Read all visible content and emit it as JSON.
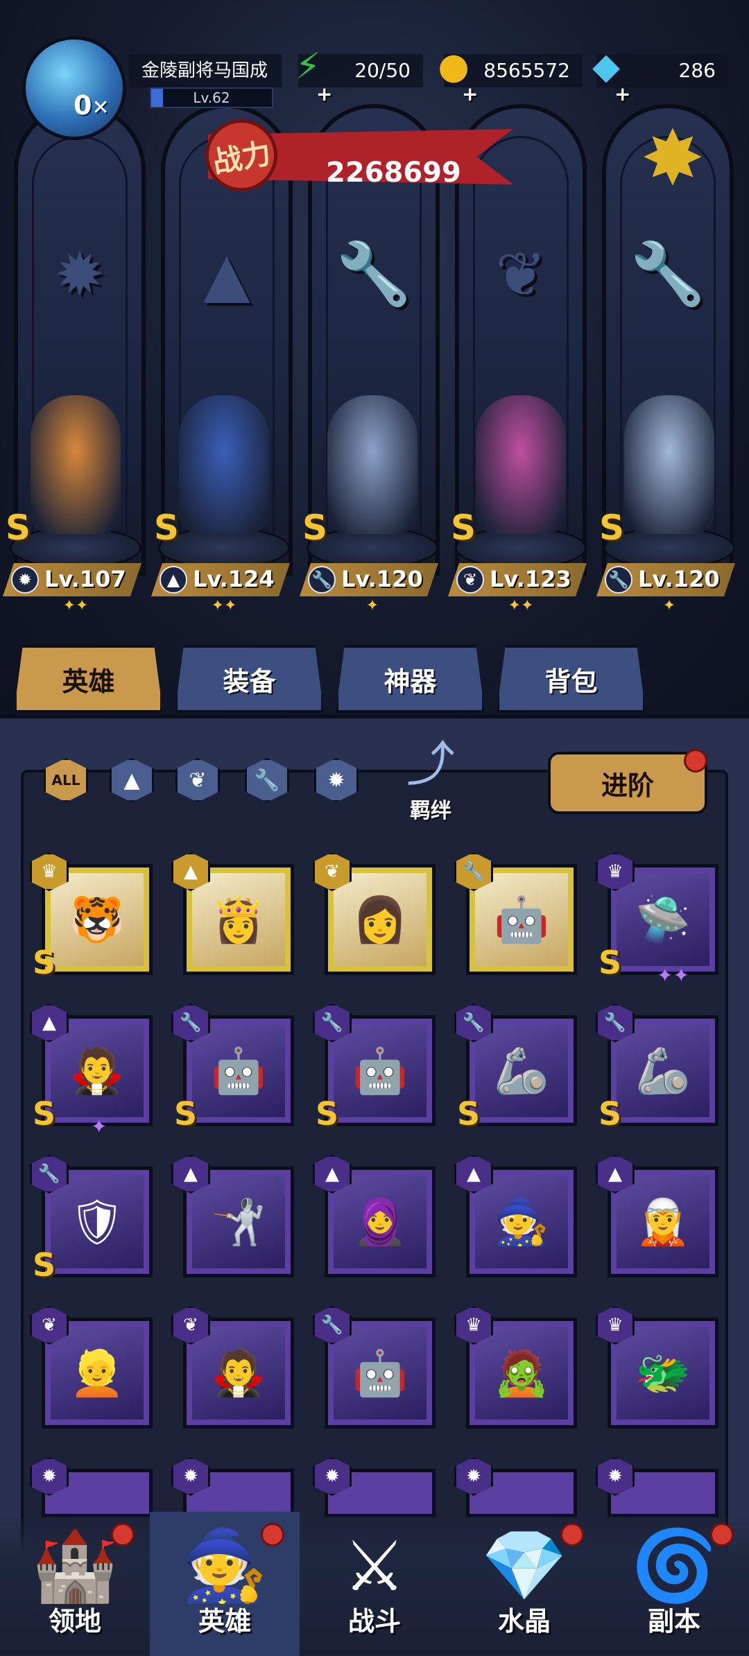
{
  "header": {
    "avatar_vip": "0",
    "avatar_close": "✕",
    "player_name": "金陵副将马国成",
    "player_level": "Lv.62",
    "stamina": "20/50",
    "gold": "8565572",
    "diamonds": "286",
    "power_badge": "战力",
    "power_value": "2268699"
  },
  "heroes_lineup": [
    {
      "level": "Lv.107",
      "rank": "S",
      "stars": "✦✦",
      "class_icon": "beast-claw-icon",
      "color": "#d8883a"
    },
    {
      "level": "Lv.124",
      "rank": "S",
      "stars": "✦✦",
      "class_icon": "mage-hat-icon",
      "color": "#3a5fb8"
    },
    {
      "level": "Lv.120",
      "rank": "S",
      "stars": "✦",
      "class_icon": "wrench-icon",
      "color": "#8ba2c8"
    },
    {
      "level": "Lv.123",
      "rank": "S",
      "stars": "✦✦",
      "class_icon": "wing-icon",
      "color": "#c04fa0"
    },
    {
      "level": "Lv.120",
      "rank": "S",
      "stars": "✦",
      "class_icon": "wrench-icon",
      "color": "#a0b8d8"
    }
  ],
  "tabs": [
    "英雄",
    "装备",
    "神器",
    "背包"
  ],
  "filters": {
    "all": "ALL",
    "bond_label": "羁绊",
    "advance_label": "进阶"
  },
  "grid": [
    {
      "frame": "gold",
      "class": "♛",
      "rank": "S",
      "star": "",
      "portrait": "🐯"
    },
    {
      "frame": "gold",
      "class": "▲",
      "rank": "",
      "star": "",
      "portrait": "👸"
    },
    {
      "frame": "gold",
      "class": "❦",
      "rank": "",
      "star": "",
      "portrait": "👩"
    },
    {
      "frame": "gold",
      "class": "🔧",
      "rank": "",
      "star": "",
      "portrait": "🤖"
    },
    {
      "frame": "purple",
      "class": "♛",
      "rank": "S",
      "star": "✦✦",
      "portrait": "🛸"
    },
    {
      "frame": "purple",
      "class": "▲",
      "rank": "S",
      "star": "✦",
      "portrait": "🧛"
    },
    {
      "frame": "purple",
      "class": "🔧",
      "rank": "S",
      "star": "",
      "portrait": "🤖"
    },
    {
      "frame": "purple",
      "class": "🔧",
      "rank": "S",
      "star": "",
      "portrait": "🤖"
    },
    {
      "frame": "purple",
      "class": "🔧",
      "rank": "S",
      "star": "",
      "portrait": "🦾"
    },
    {
      "frame": "purple",
      "class": "🔧",
      "rank": "S",
      "star": "",
      "portrait": "🦾"
    },
    {
      "frame": "purple",
      "class": "🔧",
      "rank": "S",
      "star": "",
      "portrait": "🛡"
    },
    {
      "frame": "purple",
      "class": "▲",
      "rank": "",
      "star": "",
      "portrait": "🤺"
    },
    {
      "frame": "purple",
      "class": "▲",
      "rank": "",
      "star": "",
      "portrait": "🧕"
    },
    {
      "frame": "purple",
      "class": "▲",
      "rank": "",
      "star": "",
      "portrait": "🧙"
    },
    {
      "frame": "purple",
      "class": "▲",
      "rank": "",
      "star": "",
      "portrait": "🧝"
    },
    {
      "frame": "purple",
      "class": "❦",
      "rank": "",
      "star": "",
      "portrait": "👱"
    },
    {
      "frame": "purple",
      "class": "❦",
      "rank": "",
      "star": "",
      "portrait": "🧛"
    },
    {
      "frame": "purple",
      "class": "🔧",
      "rank": "",
      "star": "",
      "portrait": "🤖"
    },
    {
      "frame": "purple",
      "class": "♛",
      "rank": "",
      "star": "",
      "portrait": "🧟"
    },
    {
      "frame": "purple",
      "class": "♛",
      "rank": "",
      "star": "",
      "portrait": "🐲"
    }
  ],
  "bottom_nav": [
    {
      "label": "领地",
      "icon": "castle-icon",
      "glyph": "🏰",
      "badge": true,
      "active": false
    },
    {
      "label": "英雄",
      "icon": "wizard-hat-icon",
      "glyph": "🧙",
      "badge": true,
      "active": true
    },
    {
      "label": "战斗",
      "icon": "sword-icon",
      "glyph": "⚔",
      "badge": false,
      "active": false
    },
    {
      "label": "水晶",
      "icon": "crystal-icon",
      "glyph": "💎",
      "badge": true,
      "active": false
    },
    {
      "label": "副本",
      "icon": "portal-icon",
      "glyph": "🌀",
      "badge": true,
      "active": false
    }
  ]
}
